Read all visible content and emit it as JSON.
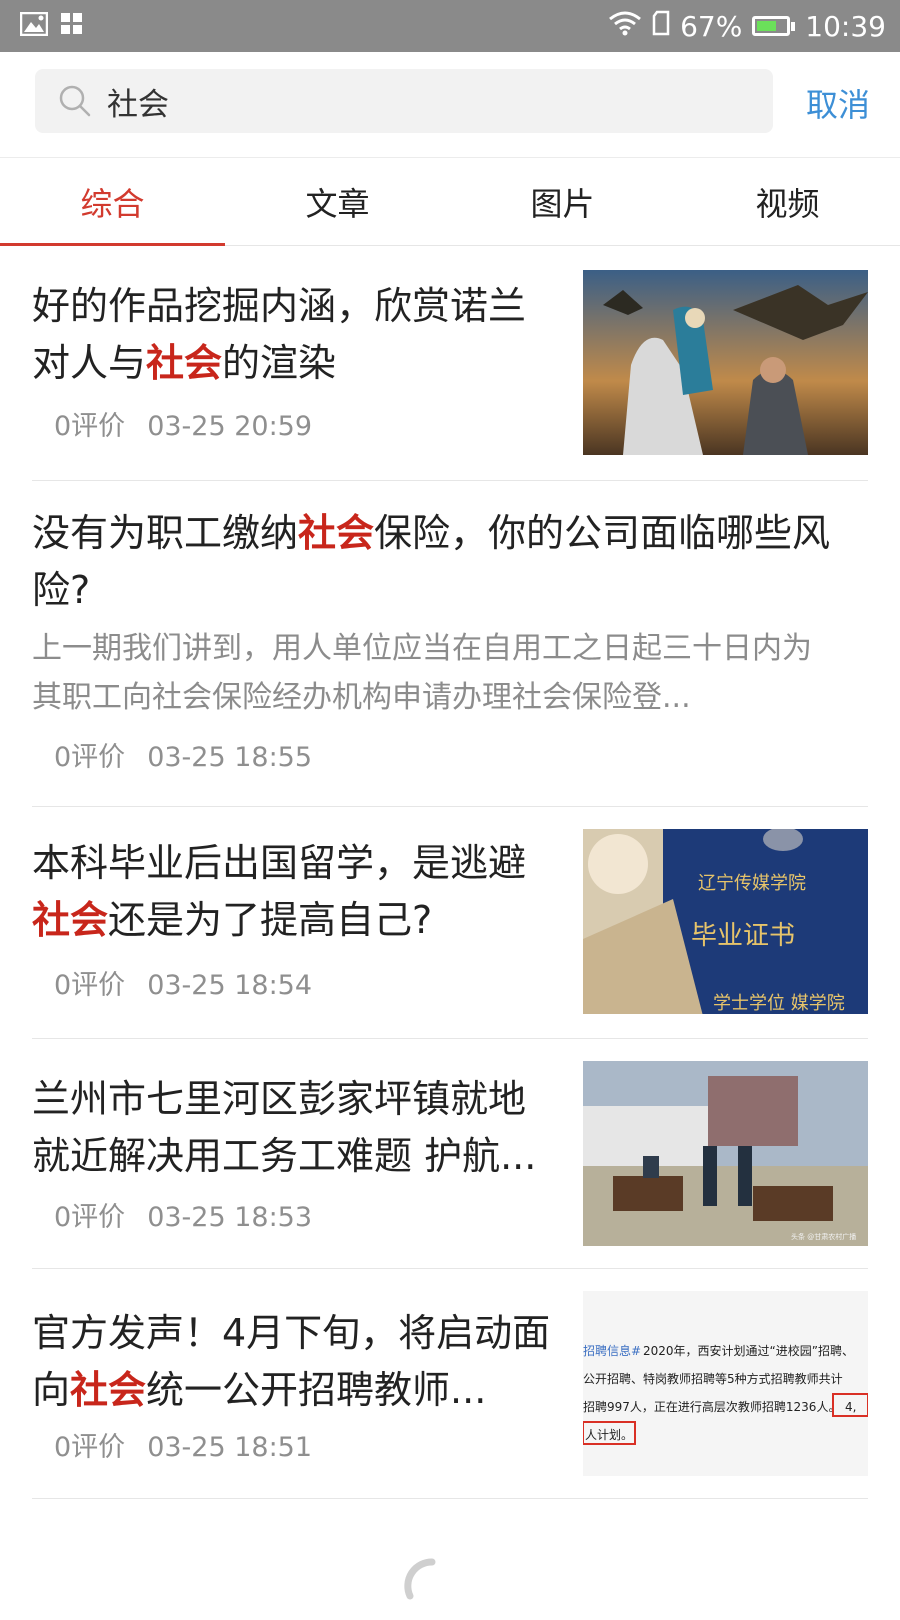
{
  "status_bar": {
    "battery_percent": "67%",
    "time": "10:39",
    "battery_level": 0.67,
    "left_icons": [
      "image-icon",
      "apps-icon"
    ],
    "right_icons": [
      "wifi-icon",
      "sim-icon",
      "battery-icon"
    ]
  },
  "search": {
    "query": "社会",
    "cancel_label": "取消"
  },
  "tabs": [
    {
      "label": "综合",
      "active": true
    },
    {
      "label": "文章",
      "active": false
    },
    {
      "label": "图片",
      "active": false
    },
    {
      "label": "视频",
      "active": false
    }
  ],
  "colors": {
    "accent": "#d23a2e",
    "highlight": "#c8261b",
    "link": "#3d8fd6",
    "status_bar": "#8a8a8a"
  },
  "articles": [
    {
      "title_parts": [
        "好的作品挖掘内涵，欣赏诺兰对人与",
        "社会",
        "的渲染"
      ],
      "comments": "0评价",
      "time": "03-25 20:59",
      "thumbnail": "dragon-rider-photo"
    },
    {
      "title_parts": [
        "没有为职工缴纳",
        "社会",
        "保险，你的公司面临哪些风险?"
      ],
      "summary": "上一期我们讲到，用人单位应当在自用工之日起三十日内为其职工向社会保险经办机构申请办理社会保险登...",
      "comments": "0评价",
      "time": "03-25 18:55"
    },
    {
      "title_parts": [
        "本科毕业后出国留学，是逃避",
        "社会",
        "还是为了提高自己?"
      ],
      "comments": "0评价",
      "time": "03-25 18:54",
      "thumbnail": "diploma-photo",
      "thumb_text": {
        "school": "辽宁传媒学院",
        "cert": "毕业证书",
        "bottom": "学士学位 媒学院"
      }
    },
    {
      "title_parts": [
        "兰州市七里河区彭家坪镇就地就近解决用工务工难题 护航..."
      ],
      "comments": "0评价",
      "time": "03-25 18:53",
      "thumbnail": "outdoor-recruitment-photo",
      "thumb_text": {
        "watermark": "头条 @甘肃农村广播"
      }
    },
    {
      "title_parts": [
        "官方发声！4月下旬，将启动面向",
        "社会",
        "统一公开招聘教师..."
      ],
      "comments": "0评价",
      "time": "03-25 18:51",
      "thumbnail": "text-screenshot-photo",
      "thumb_text": {
        "line1a": "招聘信息#",
        "line1b": " 2020年，西安计划通过“进校园”招聘、",
        "line2": "公开招聘、特岗教师招聘等5种方式招聘教师共计",
        "line3a": "招聘997人，正在进行高层次教师招聘1236人。",
        "line3b": "4,",
        "line4": "人计划。"
      }
    }
  ]
}
